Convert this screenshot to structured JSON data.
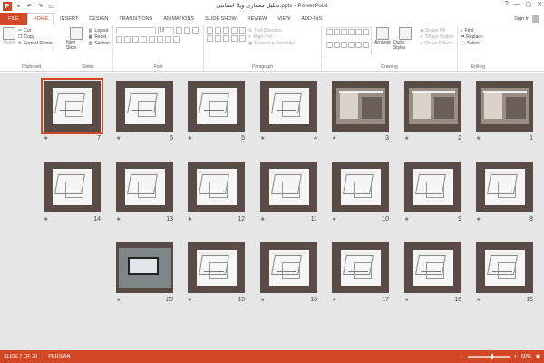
{
  "app": {
    "title": "تحلیل معماری ویلا استانبی.pptx - PowerPoint",
    "logo": "P",
    "accent": "#d24726"
  },
  "qat": {
    "save_icon": "save-icon",
    "undo_icon": "undo-icon",
    "redo_icon": "redo-icon",
    "start_icon": "start-slideshow-icon"
  },
  "window": {
    "help": "?",
    "minimize": "—",
    "restore": "▢",
    "close": "✕"
  },
  "tabs": [
    {
      "label": "FILE"
    },
    {
      "label": "HOME"
    },
    {
      "label": "INSERT"
    },
    {
      "label": "DESIGN"
    },
    {
      "label": "TRANSITIONS"
    },
    {
      "label": "ANIMATIONS"
    },
    {
      "label": "SLIDE SHOW"
    },
    {
      "label": "REVIEW"
    },
    {
      "label": "VIEW"
    },
    {
      "label": "ADD-INS"
    }
  ],
  "signin": "Sign in",
  "ribbon": {
    "clipboard": {
      "paste": "Paste",
      "cut": "Cut",
      "copy": "Copy",
      "format_painter": "Format Painter",
      "label": "Clipboard"
    },
    "slides": {
      "new_slide": "New Slide",
      "layout": "Layout",
      "reset": "Reset",
      "section": "Section",
      "label": "Slides"
    },
    "font": {
      "size": "18",
      "label": "Font"
    },
    "paragraph": {
      "text_direction": "Text Direction",
      "align_text": "Align Text",
      "convert": "Convert to SmartArt",
      "label": "Paragraph"
    },
    "drawing": {
      "arrange": "Arrange",
      "quick_styles": "Quick Styles",
      "shape_fill": "Shape Fill",
      "shape_outline": "Shape Outline",
      "shape_effects": "Shape Effects",
      "label": "Drawing"
    },
    "editing": {
      "find": "Find",
      "replace": "Replace",
      "select": "Select",
      "label": "Editing"
    }
  },
  "slides": [
    {
      "num": "7",
      "kind": "paper",
      "selected": true
    },
    {
      "num": "6",
      "kind": "paper"
    },
    {
      "num": "5",
      "kind": "paper"
    },
    {
      "num": "4",
      "kind": "paper"
    },
    {
      "num": "3",
      "kind": "photo"
    },
    {
      "num": "2",
      "kind": "photo"
    },
    {
      "num": "1",
      "kind": "photo"
    },
    {
      "num": "14",
      "kind": "paper"
    },
    {
      "num": "13",
      "kind": "paper"
    },
    {
      "num": "12",
      "kind": "paper"
    },
    {
      "num": "11",
      "kind": "paper"
    },
    {
      "num": "10",
      "kind": "paper"
    },
    {
      "num": "9",
      "kind": "paper"
    },
    {
      "num": "8",
      "kind": "paper"
    },
    {
      "num": "20",
      "kind": "laptop"
    },
    {
      "num": "19",
      "kind": "paper"
    },
    {
      "num": "18",
      "kind": "paper"
    },
    {
      "num": "17",
      "kind": "paper"
    },
    {
      "num": "16",
      "kind": "paper"
    },
    {
      "num": "15",
      "kind": "paper"
    }
  ],
  "slide_star": "★",
  "status": {
    "slide_info": "SLIDE 7 OF 20",
    "language": "PERSIAN",
    "zoom": "60%",
    "zoom_level": 0.6
  }
}
